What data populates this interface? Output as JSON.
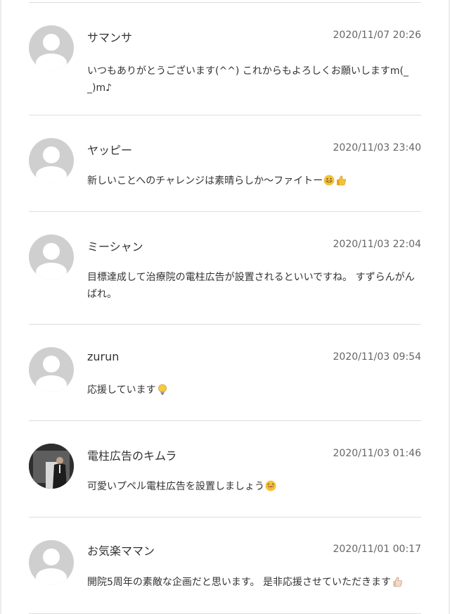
{
  "comments": [
    {
      "name": "サマンサ",
      "date": "2020/11/07 20:26",
      "text": "いつもありがとうございます(^^) これからもよろしくお願いしますm(_\n_)m♪",
      "avatar": "default-avatar-icon",
      "emoji": ""
    },
    {
      "name": "ヤッピー",
      "date": "2020/11/03 23:40",
      "text": "新しいことへのチャレンジは素晴らしか〜ファイトー",
      "avatar": "default-avatar-icon",
      "emoji": "grin-thumbs-up"
    },
    {
      "name": "ミーシャン",
      "date": "2020/11/03 22:04",
      "text": "目標達成して治療院の電柱広告が設置されるといいですね。 すずらんがん\nばれ。",
      "avatar": "default-avatar-icon",
      "emoji": ""
    },
    {
      "name": "zurun",
      "date": "2020/11/03 09:54",
      "text": "応援しています",
      "avatar": "default-avatar-icon",
      "emoji": "lightbulb"
    },
    {
      "name": "電柱広告のキムラ",
      "date": "2020/11/03 01:46",
      "text": "可愛いプペル電柱広告を設置しましょう",
      "avatar": "user-photo-avatar",
      "emoji": "laughing-face"
    },
    {
      "name": "お気楽ママン",
      "date": "2020/11/01 00:17",
      "text": "開院5周年の素敵な企画だと思います。 是非応援させていただきます",
      "avatar": "default-avatar-icon",
      "emoji": "thumbs-up-light"
    }
  ]
}
